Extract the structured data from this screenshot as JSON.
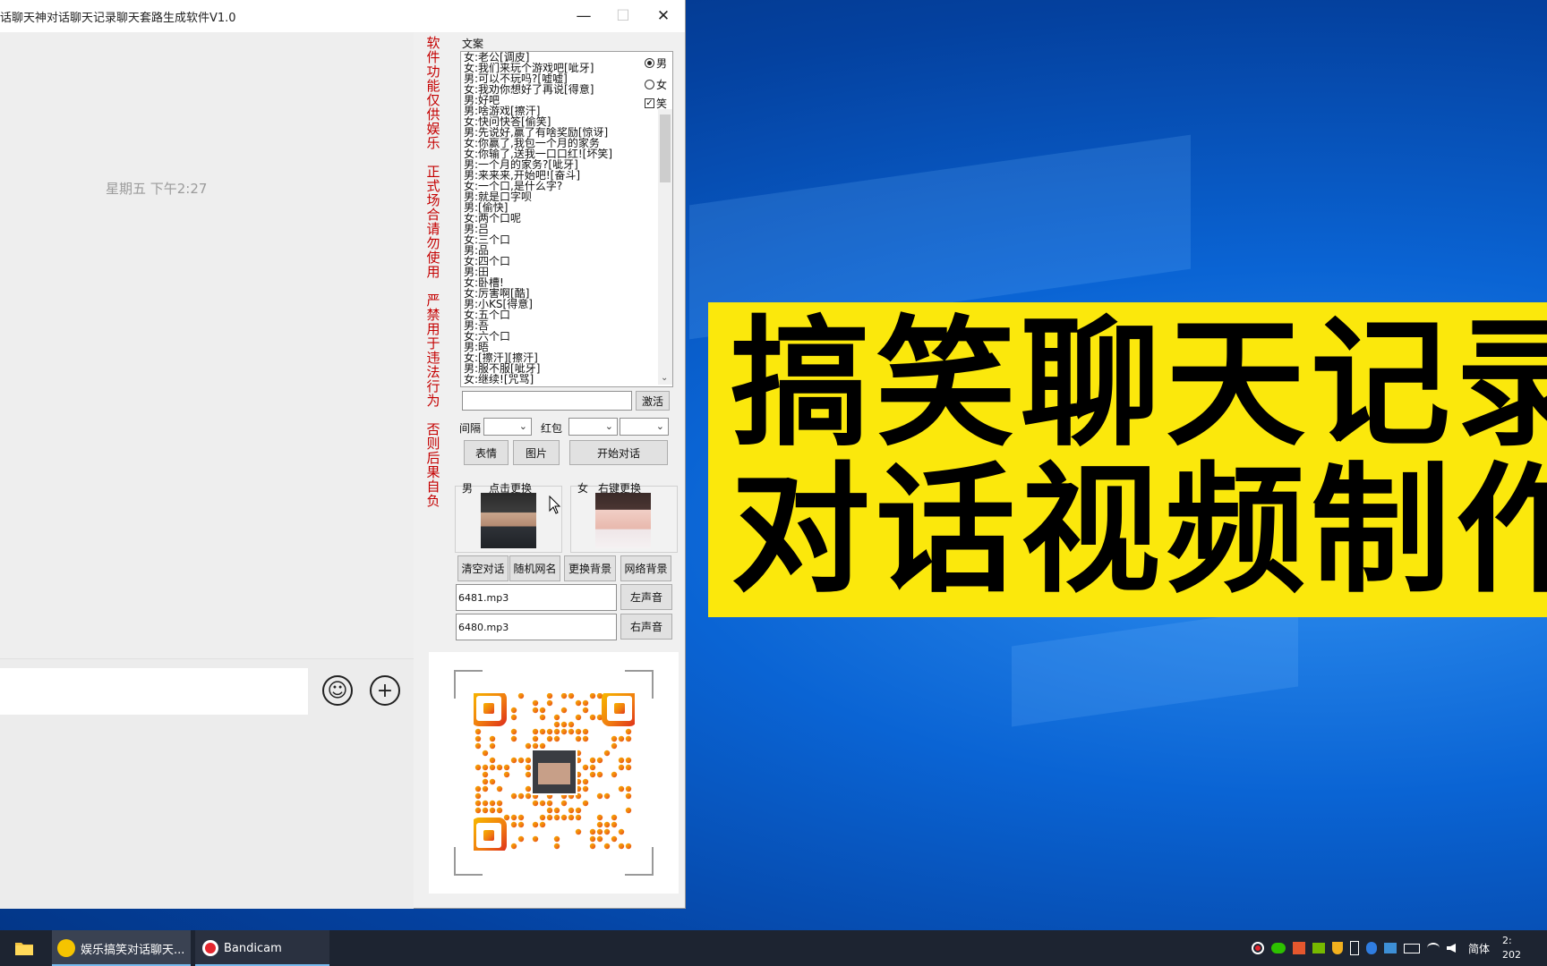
{
  "window": {
    "title": "话聊天神对话聊天记录聊天套路生成软件V1.0",
    "minimize_glyph": "—",
    "maximize_glyph": "☐",
    "close_glyph": "✕"
  },
  "chat": {
    "timestamp": "星期五 下午2:27",
    "emoji_button": "☺",
    "plus_button": "+"
  },
  "warning_lines": [
    "软件功能仅供娱乐",
    "正式场合请勿使用",
    "严禁用于违法行为",
    "否则后果自负"
  ],
  "panel": {
    "script_label": "文案",
    "script_lines": [
      "女:老公[调皮]",
      "女:我们来玩个游戏吧[呲牙]",
      "男:可以不玩吗?[嘘嘘]",
      "女:我劝你想好了再说[得意]",
      "男:好吧",
      "男:啥游戏[擦汗]",
      "女:快问快答[偷笑]",
      "男:先说好,赢了有啥奖励[惊讶]",
      "女:你赢了,我包一个月的家务",
      "女:你输了,送我一口口红![坏笑]",
      "男:一个月的家务?[呲牙]",
      "男:来来来,开始吧![奋斗]",
      "女:一个口,是什么字?",
      "男:就是口字呗",
      "男:[偷快]",
      "女:两个口呢",
      "男:吕",
      "女:三个口",
      "男:品",
      "女:四个口",
      "男:田",
      "女:卧槽!",
      "女:厉害啊[酷]",
      "男:小KS[得意]",
      "女:五个口",
      "男:吾",
      "女:六个口",
      "男:晤",
      "女:[擦汗][擦汗]",
      "男:服不服[呲牙]",
      "女:继续![咒骂]"
    ],
    "gender_male": "男",
    "gender_female": "女",
    "laugh_option": "笑",
    "check_mark": "✓",
    "activate_input": "",
    "activate_button": "激活",
    "interval_label": "间隔",
    "redpacket_label": "红包",
    "dropdown_arrow": "⌄",
    "emoji_btn": "表情",
    "image_btn": "图片",
    "start_btn": "开始对话",
    "male_label": "男",
    "male_hint": "点击更换",
    "female_label": "女",
    "female_hint": "右键更换",
    "clear_btn": "清空对话",
    "random_name_btn": "随机网名",
    "change_bg_btn": "更换背景",
    "web_bg_btn": "网络背景",
    "left_sound_file": "6481.mp3",
    "right_sound_file": "6480.mp3",
    "left_sound_btn": "左声音",
    "right_sound_btn": "右声音"
  },
  "banner": {
    "line1": "搞笑聊天记录",
    "line2": "对话视频制作"
  },
  "taskbar": {
    "task1_label": "娱乐搞笑对话聊天...",
    "task2_label": "Bandicam",
    "ime_label": "简体",
    "clock_time": "2:",
    "clock_date": "202",
    "colors": {
      "accent": "#76b9ed",
      "banner": "#fbe80c",
      "warning": "#c40000"
    }
  }
}
